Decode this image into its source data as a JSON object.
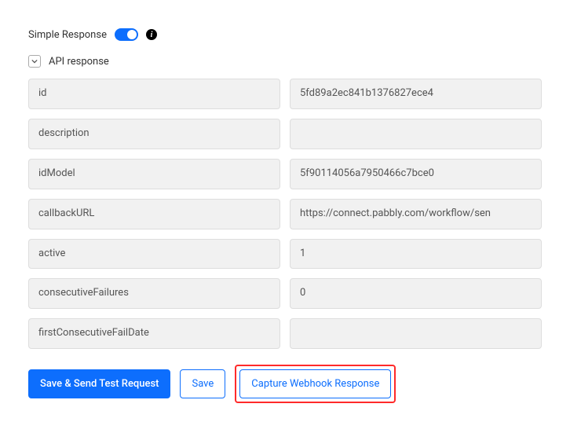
{
  "header": {
    "simpleResponseLabel": "Simple Response",
    "infoGlyph": "i"
  },
  "section": {
    "title": "API response"
  },
  "fields": [
    {
      "key": "id",
      "value": "5fd89a2ec841b1376827ece4",
      "scroll": false
    },
    {
      "key": "description",
      "value": "",
      "scroll": false
    },
    {
      "key": "idModel",
      "value": "5f90114056a7950466c7bce0",
      "scroll": false
    },
    {
      "key": "callbackURL",
      "value": "https://connect.pabbly.com/workflow/sen",
      "scroll": true
    },
    {
      "key": "active",
      "value": "1",
      "scroll": false
    },
    {
      "key": "consecutiveFailures",
      "value": "0",
      "scroll": false
    },
    {
      "key": "firstConsecutiveFailDate",
      "value": "",
      "scroll": false
    }
  ],
  "buttons": {
    "saveSend": "Save & Send Test Request",
    "save": "Save",
    "capture": "Capture Webhook Response"
  }
}
